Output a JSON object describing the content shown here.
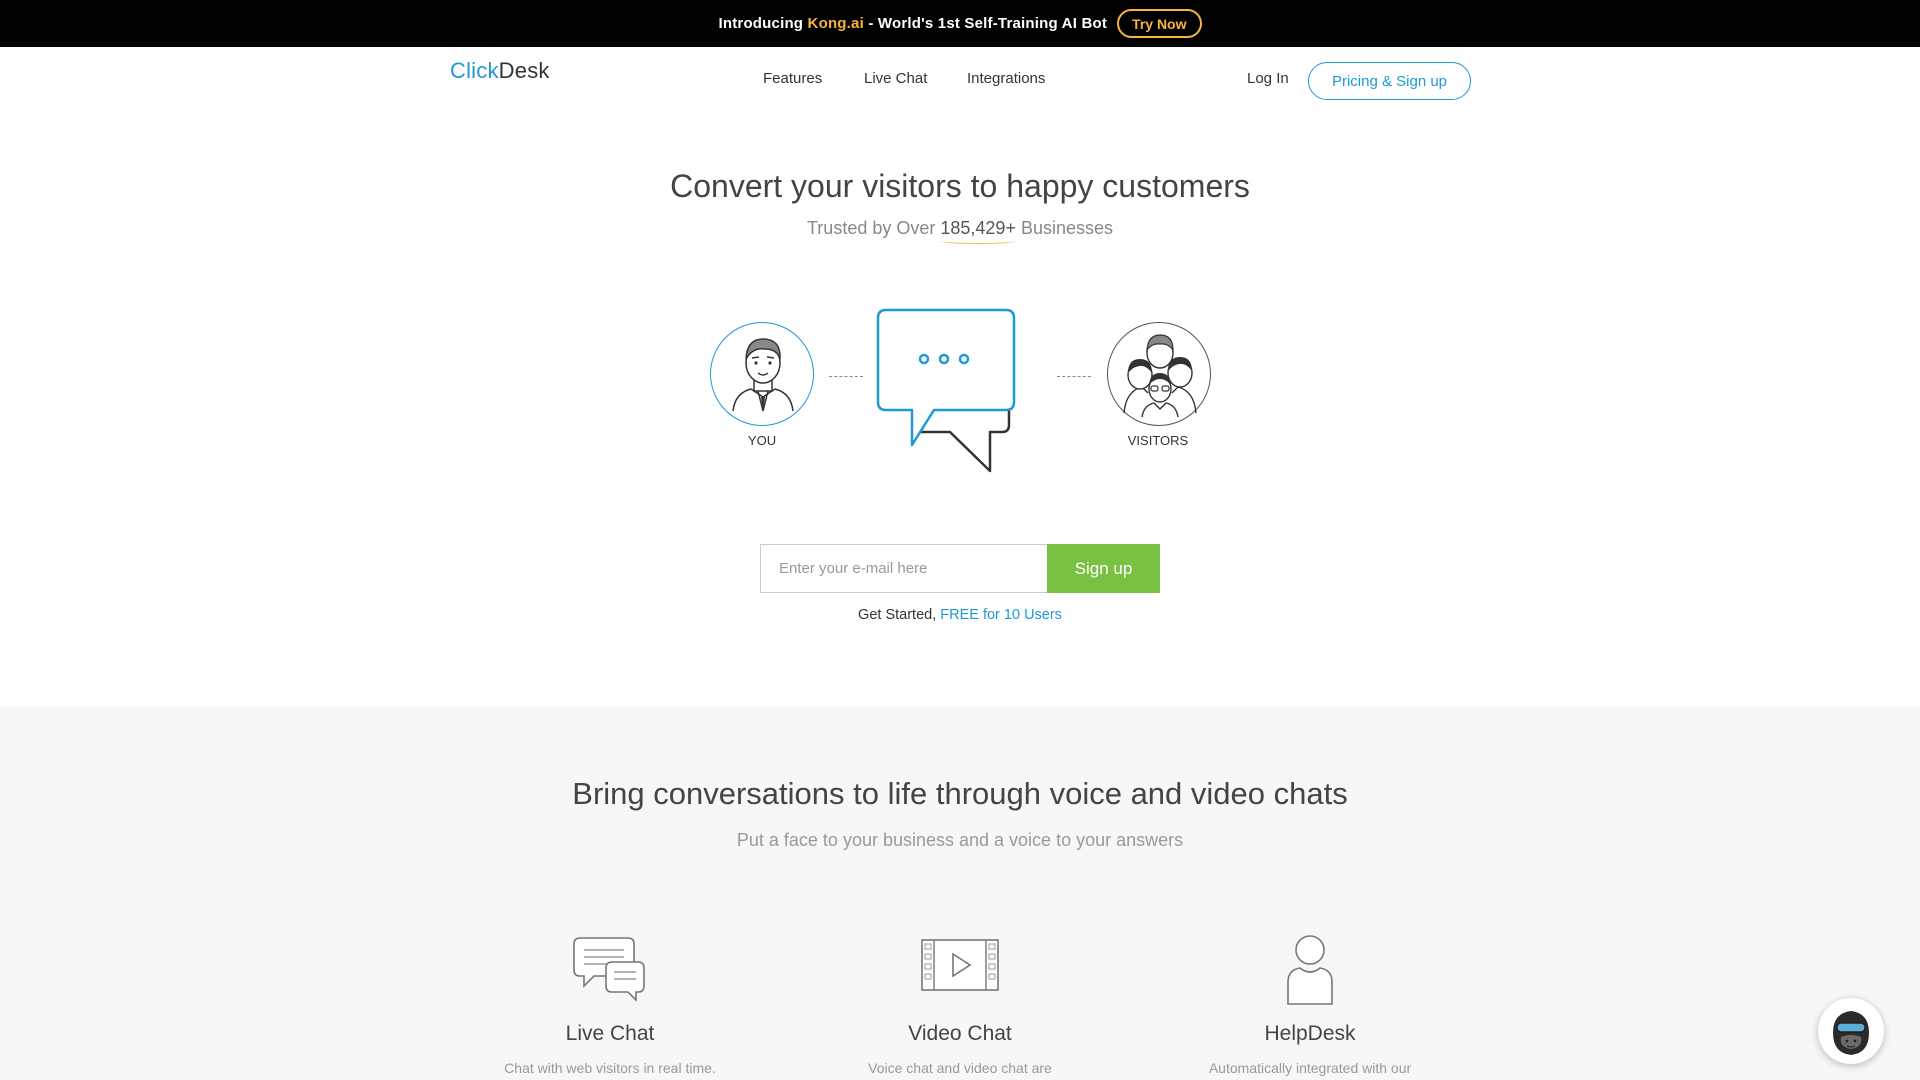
{
  "announcement": {
    "prefix": "Introducing ",
    "product": "Kong.ai",
    "suffix": " - World's 1st Self-Training AI Bot",
    "cta": "Try Now"
  },
  "header": {
    "logo_part1": "Click",
    "logo_part2": "Desk",
    "nav": [
      "Features",
      "Live Chat",
      "Integrations"
    ],
    "login": "Log In",
    "pricing": "Pricing & Sign up"
  },
  "hero": {
    "title": "Convert your visitors to happy customers",
    "sub_prefix": "Trusted by Over ",
    "count": "185,429+",
    "sub_suffix": " Businesses",
    "you_label": "YOU",
    "visitors_label": "VISITORS"
  },
  "signup": {
    "placeholder": "Enter your e-mail here",
    "button": "Sign up",
    "note_prefix": "Get Started, ",
    "note_free": "FREE for 10 Users"
  },
  "features": {
    "title": "Bring conversations to life through voice and video chats",
    "subtitle": "Put a face to your business and a voice to your answers",
    "items": [
      {
        "name": "Live Chat",
        "desc": "Chat with web visitors in real time.",
        "icon": "chat-bubbles-icon"
      },
      {
        "name": "Video Chat",
        "desc": "Voice chat and video chat are",
        "icon": "video-film-icon"
      },
      {
        "name": "HelpDesk",
        "desc": "Automatically integrated with our",
        "icon": "person-icon"
      }
    ]
  },
  "colors": {
    "brand_blue": "#1e9ad3",
    "accent_orange": "#f6b53a",
    "signup_green": "#7ac043"
  }
}
